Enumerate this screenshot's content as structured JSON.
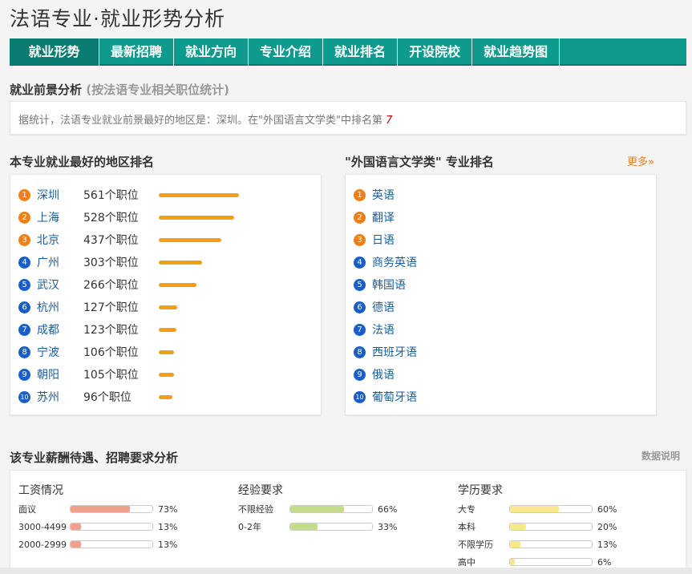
{
  "page_title": "法语专业·就业形势分析",
  "tabs": [
    {
      "label": "就业形势"
    },
    {
      "label": "最新招聘"
    },
    {
      "label": "就业方向"
    },
    {
      "label": "专业介绍"
    },
    {
      "label": "就业排名"
    },
    {
      "label": "开设院校"
    },
    {
      "label": "就业趋势图"
    }
  ],
  "prospect": {
    "title": "就业前景分析",
    "note": "(按法语专业相关职位统计)",
    "text": "据统计，法语专业就业前景最好的地区是：深圳。在\"外国语言文学类\"中排名第",
    "rank": "7"
  },
  "regions": {
    "title": "本专业就业最好的地区排名",
    "items": [
      {
        "rank": "1",
        "city": "深圳",
        "jobs": "561个职位",
        "value": 561
      },
      {
        "rank": "2",
        "city": "上海",
        "jobs": "528个职位",
        "value": 528
      },
      {
        "rank": "3",
        "city": "北京",
        "jobs": "437个职位",
        "value": 437
      },
      {
        "rank": "4",
        "city": "广州",
        "jobs": "303个职位",
        "value": 303
      },
      {
        "rank": "5",
        "city": "武汉",
        "jobs": "266个职位",
        "value": 266
      },
      {
        "rank": "6",
        "city": "杭州",
        "jobs": "127个职位",
        "value": 127
      },
      {
        "rank": "7",
        "city": "成都",
        "jobs": "123个职位",
        "value": 123
      },
      {
        "rank": "8",
        "city": "宁波",
        "jobs": "106个职位",
        "value": 106
      },
      {
        "rank": "9",
        "city": "朝阳",
        "jobs": "105个职位",
        "value": 105
      },
      {
        "rank": "10",
        "city": "苏州",
        "jobs": "96个职位",
        "value": 96
      }
    ]
  },
  "majors": {
    "title": "\"外国语言文学类\" 专业排名",
    "more": "更多»",
    "items": [
      {
        "rank": "1",
        "name": "英语"
      },
      {
        "rank": "2",
        "name": "翻译"
      },
      {
        "rank": "3",
        "name": "日语"
      },
      {
        "rank": "4",
        "name": "商务英语"
      },
      {
        "rank": "5",
        "name": "韩国语"
      },
      {
        "rank": "6",
        "name": "德语"
      },
      {
        "rank": "7",
        "name": "法语"
      },
      {
        "rank": "8",
        "name": "西班牙语"
      },
      {
        "rank": "9",
        "name": "俄语"
      },
      {
        "rank": "10",
        "name": "葡萄牙语"
      }
    ]
  },
  "salary": {
    "title": "该专业薪酬待遇、招聘要求分析",
    "data_note": "数据说明",
    "columns": [
      {
        "title": "工资情况",
        "color": "#f0a08c",
        "rows": [
          {
            "label": "面议",
            "pct": "73%",
            "value": 73
          },
          {
            "label": "3000-4499",
            "pct": "13%",
            "value": 13
          },
          {
            "label": "2000-2999",
            "pct": "13%",
            "value": 13
          }
        ]
      },
      {
        "title": "经验要求",
        "color": "#c5dc8c",
        "rows": [
          {
            "label": "不限经验",
            "pct": "66%",
            "value": 66
          },
          {
            "label": "0-2年",
            "pct": "33%",
            "value": 33
          }
        ]
      },
      {
        "title": "学历要求",
        "color": "#f7e98a",
        "rows": [
          {
            "label": "大专",
            "pct": "60%",
            "value": 60
          },
          {
            "label": "本科",
            "pct": "20%",
            "value": 20
          },
          {
            "label": "不限学历",
            "pct": "13%",
            "value": 13
          },
          {
            "label": "高中",
            "pct": "6%",
            "value": 6
          }
        ]
      }
    ]
  },
  "colors": {
    "tab_bg": "#0e9a8c",
    "tab_active": "#0a7b70",
    "link": "#1a5c9c",
    "bar": "#f59c1a",
    "badge_top": "#f07f1a",
    "badge_rest": "#1a5ec9"
  }
}
